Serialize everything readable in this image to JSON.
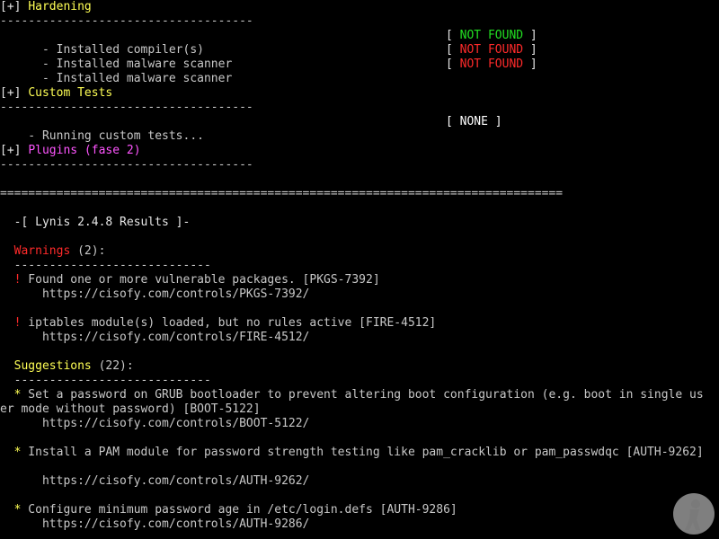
{
  "terminal": {
    "hardening": {
      "bracket": "[+]",
      "title": "Hardening",
      "rule": "------------------------------------",
      "items": [
        {
          "label": "    - Installed compiler(s)",
          "status_open": "[ ",
          "status": "NOT FOUND",
          "status_close": " ]",
          "color": "#22e022"
        },
        {
          "label": "    - Installed malware scanner",
          "status_open": "[ ",
          "status": "NOT FOUND",
          "status_close": " ]",
          "color": "#ff2a2a"
        },
        {
          "label": "    - Installed malware scanner",
          "status_open": "[ ",
          "status": "NOT FOUND",
          "status_close": " ]",
          "color": "#ff2a2a"
        }
      ]
    },
    "custom_tests": {
      "bracket": "[+]",
      "title": "Custom Tests",
      "rule": "------------------------------------",
      "item_label": "  - Running custom tests...",
      "item_status": "[ NONE ]"
    },
    "plugins": {
      "bracket": "[+]",
      "title": "Plugins (fase 2)",
      "rule": "------------------------------------"
    },
    "separator": "================================================================================",
    "results_header": "  -[ Lynis 2.4.8 Results ]-",
    "warnings": {
      "title": "Warnings",
      "count": " (2):",
      "rule": "  ----------------------------",
      "bullet": "!",
      "items": [
        {
          "text": " Found one or more vulnerable packages. [PKGS-7392]",
          "url": "      https://cisofy.com/controls/PKGS-7392/"
        },
        {
          "text": " iptables module(s) loaded, but no rules active [FIRE-4512]",
          "url": "      https://cisofy.com/controls/FIRE-4512/"
        }
      ]
    },
    "suggestions": {
      "title": "Suggestions",
      "count": " (22):",
      "rule": "  ----------------------------",
      "bullet": "*",
      "items": [
        {
          "line1": " Set a password on GRUB bootloader to prevent altering boot configuration (e.g. boot in single us",
          "line2": "er mode without password) [BOOT-5122]",
          "url": "      https://cisofy.com/controls/BOOT-5122/"
        },
        {
          "line1": " Install a PAM module for password strength testing like pam_cracklib or pam_passwdqc [AUTH-9262]",
          "url": "      https://cisofy.com/controls/AUTH-9262/"
        },
        {
          "line1": " Configure minimum password age in /etc/login.defs [AUTH-9286]",
          "url": "      https://cisofy.com/controls/AUTH-9286/"
        }
      ]
    }
  },
  "colors": {
    "background": "#000000",
    "text": "#c8c8c8",
    "heading": "#ffff55",
    "plugins": "#ff55ff",
    "warning": "#ff2a2a",
    "found": "#22e022"
  },
  "icons": {
    "watermark": "person-logo-icon"
  }
}
